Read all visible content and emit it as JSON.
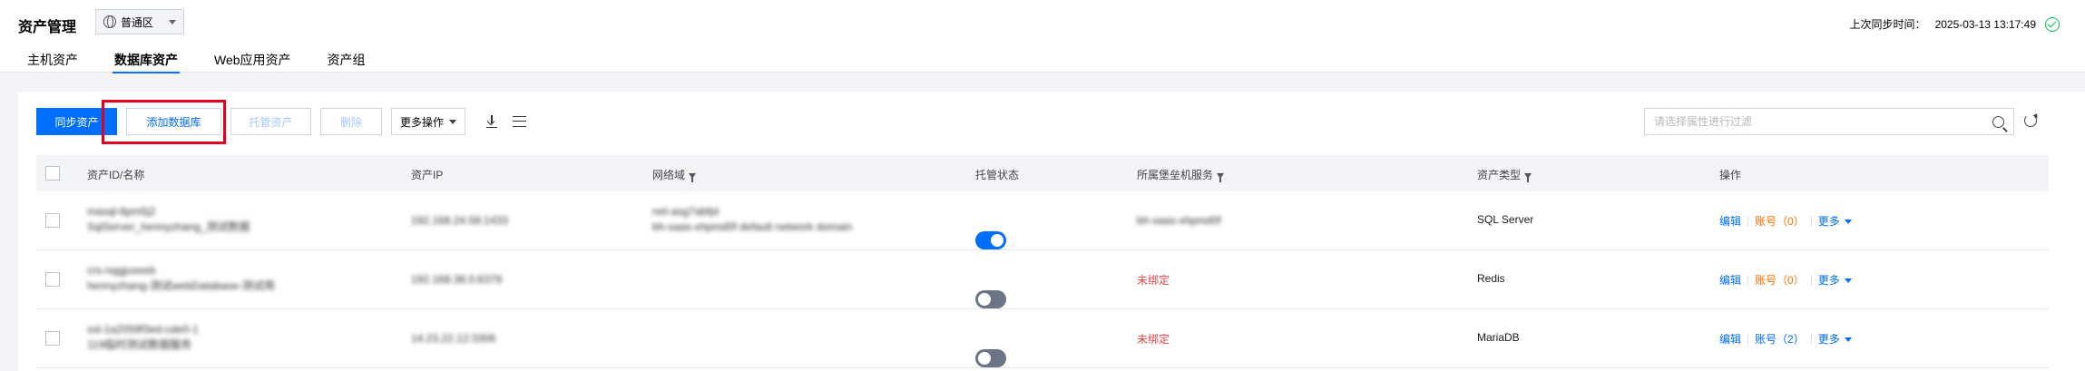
{
  "header": {
    "title": "资产管理",
    "region": "普通区",
    "sync_label": "上次同步时间：",
    "sync_time": "2025-03-13 13:17:49"
  },
  "tabs": [
    {
      "label": "主机资产",
      "active": false
    },
    {
      "label": "数据库资产",
      "active": true
    },
    {
      "label": "Web应用资产",
      "active": false
    },
    {
      "label": "资产组",
      "active": false
    }
  ],
  "toolbar": {
    "sync_btn": "同步资产",
    "add_db_btn": "添加数据库",
    "host_btn": "托管资产",
    "delete_btn": "删除",
    "more_btn": "更多操作"
  },
  "search": {
    "placeholder": "请选择属性进行过滤"
  },
  "table": {
    "columns": [
      "资产ID/名称",
      "资产IP",
      "网络域",
      "托管状态",
      "所属堡垒机服务",
      "资产类型",
      "操作"
    ],
    "rows": [
      {
        "id": "masql-6pm5j2",
        "name": "SqlServer_hennyzhang_测试数据",
        "ip": "192.168.24.58:1433",
        "domain_line1": "net-asg7abfpt",
        "domain_line2": "bh-saas-xhpmd0f default network domain",
        "managed": true,
        "bastion": "bh-saas-xhpmd0f",
        "bastion_unbound": false,
        "type": "SQL Server",
        "ops": {
          "edit": "编辑",
          "account": "账号（0）",
          "more": "更多"
        }
      },
      {
        "id": "crs-nqgjuxeeb",
        "name": "hennyzhang-测试webDatabase-测试用",
        "ip": "192.168.38.5:6379",
        "domain_line1": "",
        "domain_line2": "",
        "managed": false,
        "bastion": "未绑定",
        "bastion_unbound": true,
        "type": "Redis",
        "ops": {
          "edit": "编辑",
          "account": "账号（0）",
          "more": "更多"
        }
      },
      {
        "id": "ssl-1a2059f3ed-cde0-1",
        "name": "119临时测试数据服务",
        "ip": "14.23.22.12:3306",
        "domain_line1": "",
        "domain_line2": "",
        "managed": false,
        "bastion": "未绑定",
        "bastion_unbound": true,
        "type": "MariaDB",
        "ops": {
          "edit": "编辑",
          "account": "账号（2）",
          "more": "更多"
        }
      }
    ]
  },
  "colors": {
    "accent": "#006eff",
    "highlight": "#e1001e",
    "danger": "#e54545",
    "warning": "#ff7200",
    "success": "#0abf5b"
  }
}
